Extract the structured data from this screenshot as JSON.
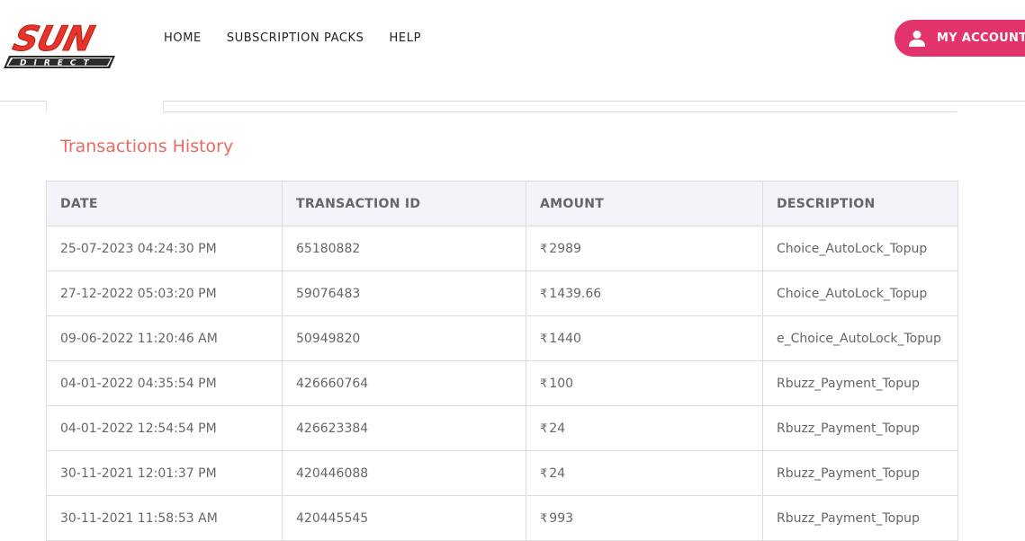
{
  "brand": {
    "name": "SUN",
    "sub": "DIRECT"
  },
  "nav": {
    "items": [
      "HOME",
      "SUBSCRIPTION PACKS",
      "HELP"
    ]
  },
  "account": {
    "label": "MY ACCOUNT"
  },
  "section": {
    "title": "Transactions History"
  },
  "table": {
    "headers": [
      "DATE",
      "TRANSACTION ID",
      "AMOUNT",
      "DESCRIPTION"
    ],
    "currency_symbol": "₹",
    "rows": [
      {
        "date": "25-07-2023 04:24:30 PM",
        "id": "65180882",
        "amount": "2989",
        "desc": "Choice_AutoLock_Topup"
      },
      {
        "date": "27-12-2022 05:03:20 PM",
        "id": "59076483",
        "amount": "1439.66",
        "desc": "Choice_AutoLock_Topup"
      },
      {
        "date": "09-06-2022 11:20:46 AM",
        "id": "50949820",
        "amount": "1440",
        "desc": "e_Choice_AutoLock_Topup"
      },
      {
        "date": "04-01-2022 04:35:54 PM",
        "id": "426660764",
        "amount": "100",
        "desc": "Rbuzz_Payment_Topup"
      },
      {
        "date": "04-01-2022 12:54:54 PM",
        "id": "426623384",
        "amount": "24",
        "desc": "Rbuzz_Payment_Topup"
      },
      {
        "date": "30-11-2021 12:01:37 PM",
        "id": "420446088",
        "amount": "24",
        "desc": "Rbuzz_Payment_Topup"
      },
      {
        "date": "30-11-2021 11:58:53 AM",
        "id": "420445545",
        "amount": "993",
        "desc": "Rbuzz_Payment_Topup"
      }
    ]
  },
  "colors": {
    "brand_red": "#e8332a",
    "accent_pink": "#e2336b",
    "title_coral": "#ea6a61",
    "header_bg": "#f3f4f9"
  }
}
